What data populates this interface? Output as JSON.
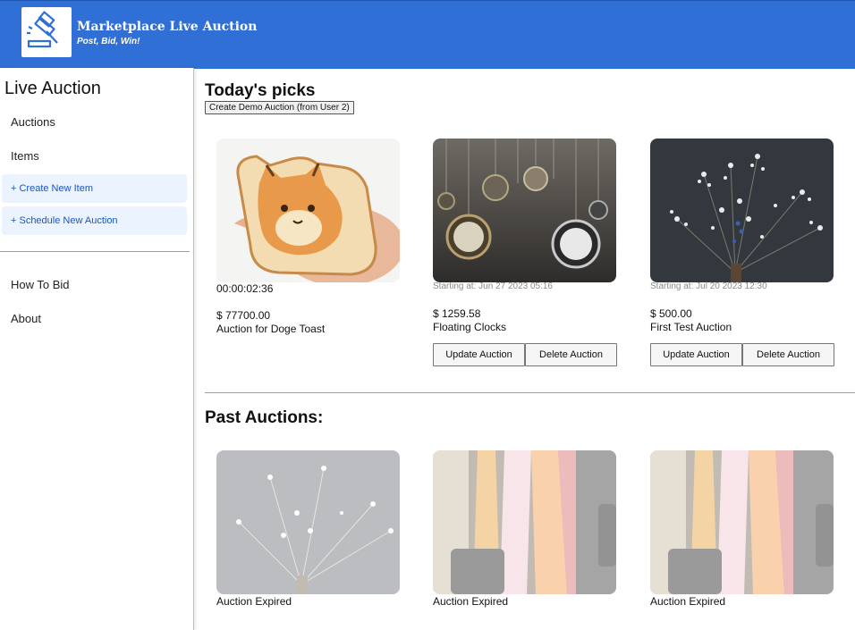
{
  "header": {
    "title": "Marketplace Live Auction",
    "tagline": "Post, Bid, Win!",
    "logo_icon": "gavel-icon"
  },
  "sidebar": {
    "title": "Live Auction",
    "items": [
      {
        "label": "Auctions"
      },
      {
        "label": "Items"
      }
    ],
    "actions": [
      {
        "label": "+ Create New Item"
      },
      {
        "label": "+ Schedule New Auction"
      }
    ],
    "footer_items": [
      {
        "label": "How To Bid"
      },
      {
        "label": "About"
      }
    ]
  },
  "main": {
    "todays_title": "Today's picks",
    "demo_button": "Create Demo Auction (from User 2)",
    "past_title": "Past Auctions:",
    "picks": [
      {
        "timer": "00:00:02:36",
        "price": "$ 77700.00",
        "title": "Auction for Doge Toast"
      },
      {
        "start": "Starting at: Jun 27 2023 05:16",
        "price": "$ 1259.58",
        "title": "Floating Clocks",
        "update": "Update Auction",
        "delete": "Delete Auction"
      },
      {
        "start": "Starting at: Jul 20 2023 12:30",
        "price": "$ 500.00",
        "title": "First Test Auction",
        "update": "Update Auction",
        "delete": "Delete Auction"
      }
    ],
    "past": [
      {
        "label": "Auction Expired"
      },
      {
        "label": "Auction Expired"
      },
      {
        "label": "Auction Expired"
      }
    ]
  },
  "colors": {
    "header": "#2f6fd6",
    "accent_bg": "#eaf3fe",
    "accent_text": "#1a56c4"
  }
}
